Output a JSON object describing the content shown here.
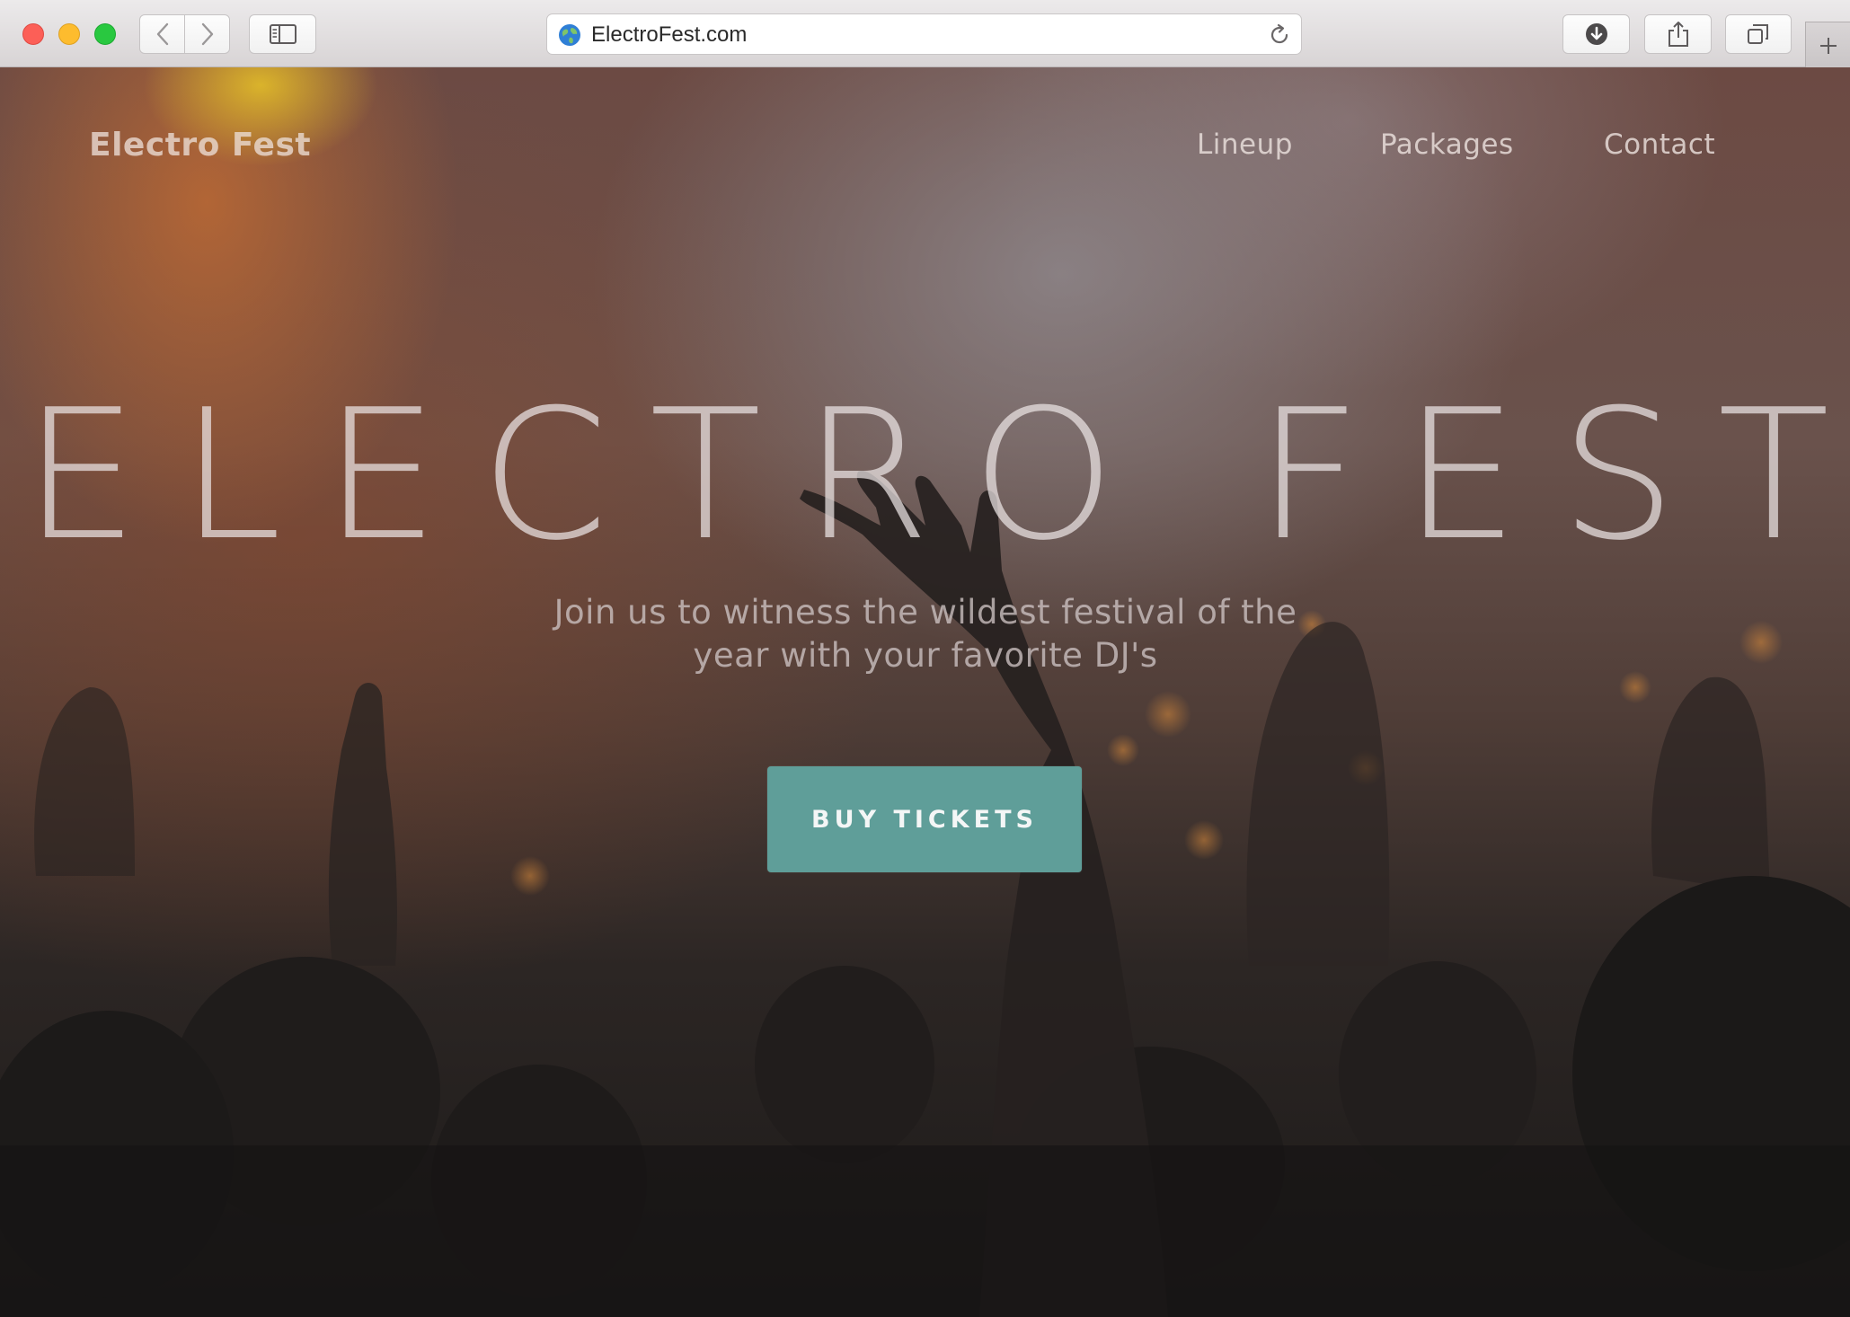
{
  "browser": {
    "url": "ElectroFest.com",
    "icons": {
      "back": "chevron-left-icon",
      "forward": "chevron-right-icon",
      "sidebar": "sidebar-icon",
      "site": "globe-icon",
      "reload": "reload-icon",
      "download": "download-icon",
      "share": "share-icon",
      "tabs": "tabs-icon",
      "new_tab": "plus-icon"
    }
  },
  "site": {
    "brand": "Electro Fest",
    "nav": [
      "Lineup",
      "Packages",
      "Contact"
    ],
    "hero_title": "ELECTRO FEST",
    "hero_subtitle_line1": "Join us to witness the wildest festival of the",
    "hero_subtitle_line2": "year with your favorite DJ's",
    "cta_label": "BUY TICKETS"
  },
  "colors": {
    "cta_background": "#5f9e99",
    "traffic_red": "#fc5f57",
    "traffic_yellow": "#fdbc2e",
    "traffic_green": "#29c840"
  }
}
